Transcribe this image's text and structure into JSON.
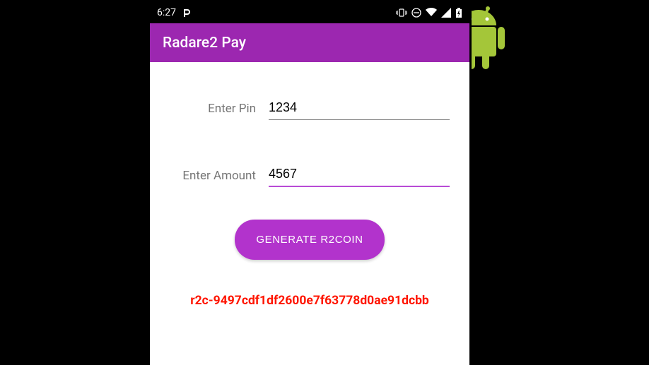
{
  "status": {
    "time": "6:27",
    "pill_icon": "P"
  },
  "app": {
    "title": "Radare2 Pay"
  },
  "form": {
    "pin_label": "Enter Pin",
    "pin_value": "1234",
    "amount_label": "Enter Amount",
    "amount_value": "4567",
    "button_label": "GENERATE R2COIN"
  },
  "result": {
    "text": "r2c-9497cdf1df2600e7f63778d0ae91dcbb"
  }
}
